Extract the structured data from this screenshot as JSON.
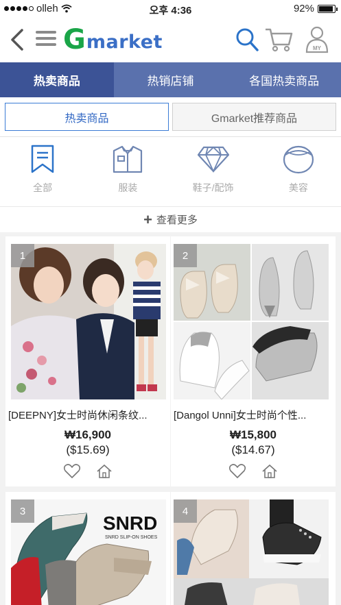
{
  "status_bar": {
    "carrier": "olleh",
    "time": "오후 4:36",
    "battery": "92%",
    "battery_level": 0.92
  },
  "header": {
    "logo_g": "G",
    "logo_rest": "market",
    "icons": [
      "back-icon",
      "menu-icon",
      "search-icon",
      "cart-icon",
      "my-account-icon"
    ],
    "my_label": "MY",
    "brand_colors": {
      "green": "#1aa548",
      "blue": "#3b6fc6"
    }
  },
  "main_tabs": [
    {
      "label": "热卖商品",
      "active": true
    },
    {
      "label": "热销店铺",
      "active": false
    },
    {
      "label": "各国热卖商品",
      "active": false
    }
  ],
  "sub_tabs": [
    {
      "label": "热卖商品",
      "active": true
    },
    {
      "label": "Gmarket推荐商品",
      "active": false
    }
  ],
  "categories": [
    {
      "label": "全部",
      "icon": "bookmark-icon"
    },
    {
      "label": "服装",
      "icon": "shirt-icon"
    },
    {
      "label": "鞋子/配饰",
      "icon": "diamond-icon"
    },
    {
      "label": "美容",
      "icon": "compact-icon"
    }
  ],
  "more_label": "查看更多",
  "products": [
    {
      "rank": "1",
      "title": "[DEEPNY]女士时尚休闲条纹...",
      "price": "₩16,900",
      "usd": "($15.69)"
    },
    {
      "rank": "2",
      "title": "[Dangol Unni]女士时尚个性...",
      "price": "₩15,800",
      "usd": "($14.67)"
    },
    {
      "rank": "3",
      "title": "",
      "price": "",
      "usd": "",
      "brand_text": "SNRD",
      "brand_sub": "SNRD SLIP-ON SHOES"
    },
    {
      "rank": "4",
      "title": "",
      "price": "",
      "usd": ""
    }
  ]
}
